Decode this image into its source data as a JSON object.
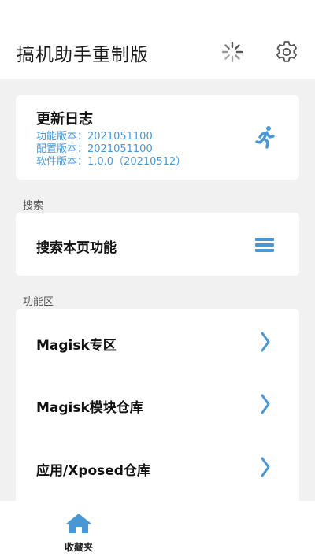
{
  "app": {
    "title": "搞机助手重制版",
    "icons": {
      "loading": "loading-spinner-icon",
      "settings": "gear-icon"
    }
  },
  "changelog": {
    "title": "更新日志",
    "lines": [
      "功能版本：2021051100",
      "配置版本：2021051100",
      "软件版本：1.0.0（20210512）"
    ],
    "icon": "running-person-icon"
  },
  "search": {
    "section_label": "搜索",
    "row_label": "搜索本页功能",
    "icon": "menu-icon"
  },
  "features": {
    "section_label": "功能区",
    "items": [
      {
        "label": "Magisk专区",
        "icon": "chevron-right-icon"
      },
      {
        "label": "Magisk模块仓库",
        "icon": "chevron-right-icon"
      },
      {
        "label": "应用/Xposed仓库",
        "icon": "chevron-right-icon"
      }
    ]
  },
  "bottom_nav": {
    "items": [
      {
        "label": "收藏夹",
        "icon": "home-icon"
      }
    ]
  },
  "colors": {
    "accent": "#4a97d6",
    "background": "#f1f1f1",
    "card": "#ffffff"
  }
}
